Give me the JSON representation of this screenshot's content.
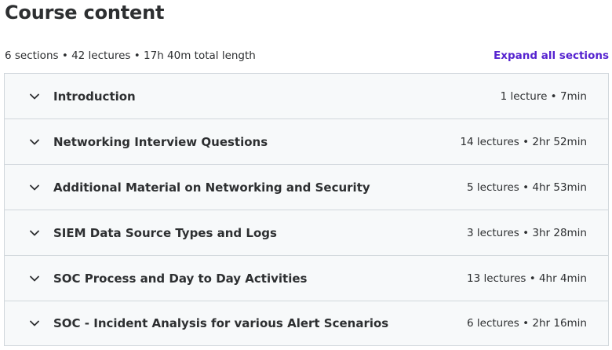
{
  "header": {
    "title": "Course content",
    "summary": "6 sections • 42 lectures • 17h 40m total length",
    "expand_all_label": "Expand all sections"
  },
  "sections": [
    {
      "title": "Introduction",
      "meta": "1 lecture • 7min"
    },
    {
      "title": "Networking Interview Questions",
      "meta": "14 lectures • 2hr 52min"
    },
    {
      "title": "Additional Material on Networking and Security",
      "meta": "5 lectures • 4hr 53min"
    },
    {
      "title": "SIEM Data Source Types and Logs",
      "meta": "3 lectures • 3hr 28min"
    },
    {
      "title": "SOC Process and Day to Day Activities",
      "meta": "13 lectures • 4hr 4min"
    },
    {
      "title": "SOC - Incident Analysis for various Alert Scenarios",
      "meta": "6 lectures • 2hr 16min"
    }
  ],
  "icons": {
    "section_toggle": "chevron-down-icon"
  },
  "colors": {
    "accent": "#5624d0",
    "text": "#2d2f31",
    "section_bg": "#f7f9fa",
    "border": "#d1d7dc"
  }
}
